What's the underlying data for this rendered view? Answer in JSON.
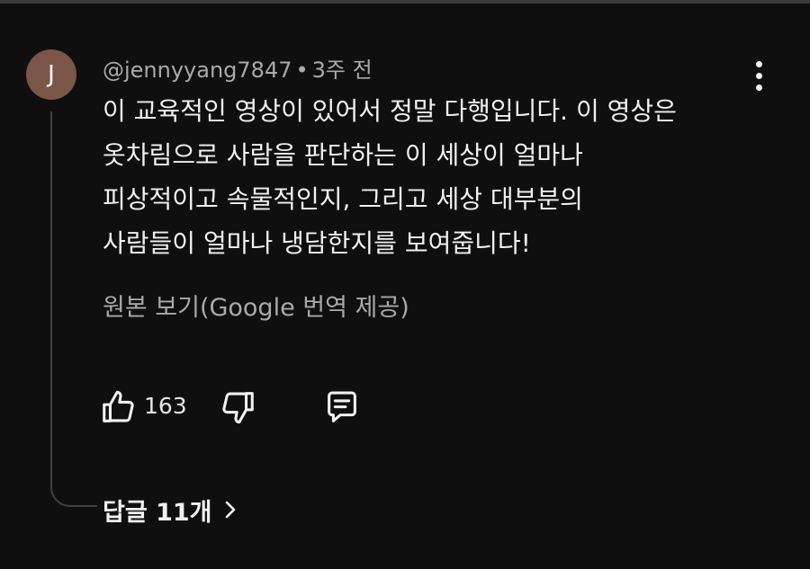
{
  "comment": {
    "avatar_initial": "J",
    "author": "@jennyyang7847",
    "separator": "•",
    "timestamp": "3주 전",
    "body_lines": [
      "이 교육적인 영상이 있어서 정말 다행입니다. 이 영상은",
      "옷차림으로 사람을 판단하는 이 세상이 얼마나",
      "피상적이고 속물적인지, 그리고 세상 대부분의",
      "사람들이 얼마나 냉담한지를 보여줍니다!"
    ],
    "translate_link": "원본 보기(Google 번역 제공)",
    "like_count": "163",
    "replies_label": "답글 11개"
  },
  "icons": {
    "more": "more-vert-icon",
    "like": "thumbs-up-icon",
    "dislike": "thumbs-down-icon",
    "reply": "comment-reply-icon",
    "expand": "chevron-right-icon"
  },
  "colors": {
    "background": "#0f0f0f",
    "avatar": "#7b5548",
    "primary_text": "#f1f1f1",
    "secondary_text": "#aaaaaa"
  }
}
